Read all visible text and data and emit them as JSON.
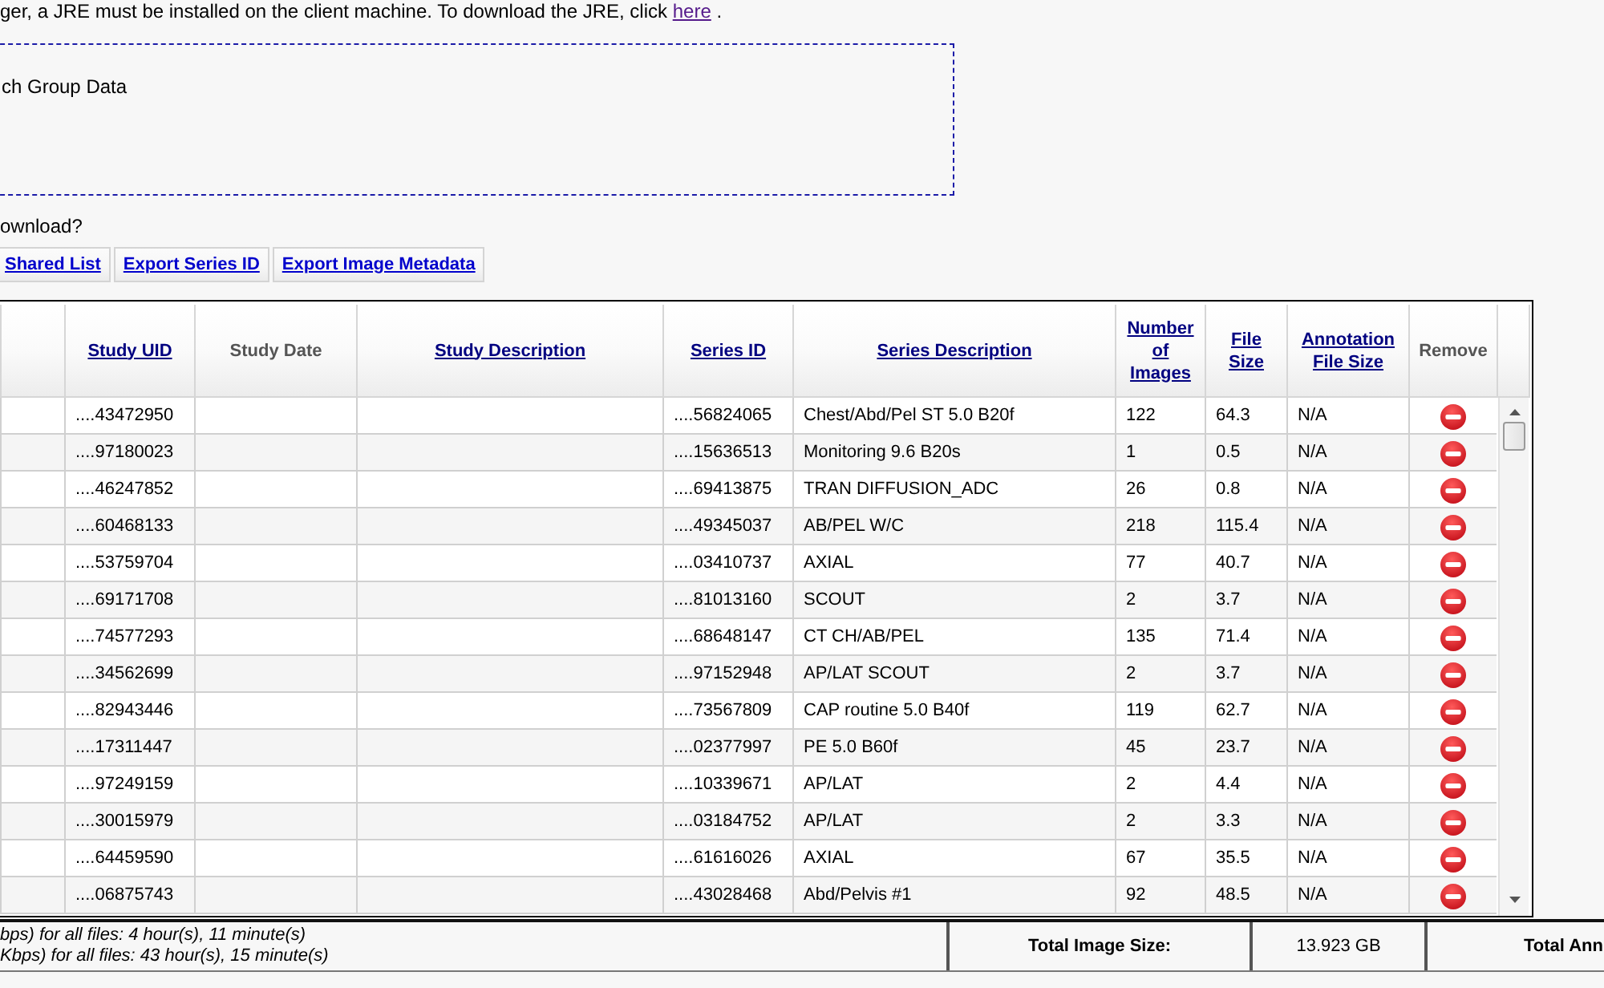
{
  "notice": {
    "text": "ger, a JRE must be installed on the client machine. To download the JRE, click",
    "link": "here",
    "suffix": "."
  },
  "group_box": {
    "label": "ch Group Data"
  },
  "question": "ownload?",
  "export_buttons": [
    "Shared List",
    "Export Series ID",
    "Export Image Metadata"
  ],
  "table": {
    "columns": [
      {
        "label": "Study UID",
        "sortable": true
      },
      {
        "label": "Study Date",
        "sortable": false
      },
      {
        "label": "Study Description",
        "sortable": true
      },
      {
        "label": "Series ID",
        "sortable": true
      },
      {
        "label": "Series Description",
        "sortable": true
      },
      {
        "label": "Number of Images",
        "sortable": true
      },
      {
        "label": "File Size",
        "sortable": true
      },
      {
        "label": "Annotation File Size",
        "sortable": true
      },
      {
        "label": "Remove",
        "sortable": false
      }
    ],
    "rows": [
      {
        "study_uid": "....43472950",
        "series_id": "....56824065",
        "series_description": "Chest/Abd/Pel ST 5.0 B20f",
        "images": "122",
        "file_size": "64.3",
        "annotation_size": "N/A"
      },
      {
        "study_uid": "....97180023",
        "series_id": "....15636513",
        "series_description": "Monitoring 9.6 B20s",
        "images": "1",
        "file_size": "0.5",
        "annotation_size": "N/A"
      },
      {
        "study_uid": "....46247852",
        "series_id": "....69413875",
        "series_description": "TRAN DIFFUSION_ADC",
        "images": "26",
        "file_size": "0.8",
        "annotation_size": "N/A"
      },
      {
        "study_uid": "....60468133",
        "series_id": "....49345037",
        "series_description": "AB/PEL W/C",
        "images": "218",
        "file_size": "115.4",
        "annotation_size": "N/A"
      },
      {
        "study_uid": "....53759704",
        "series_id": "....03410737",
        "series_description": "AXIAL",
        "images": "77",
        "file_size": "40.7",
        "annotation_size": "N/A"
      },
      {
        "study_uid": "....69171708",
        "series_id": "....81013160",
        "series_description": "SCOUT",
        "images": "2",
        "file_size": "3.7",
        "annotation_size": "N/A"
      },
      {
        "study_uid": "....74577293",
        "series_id": "....68648147",
        "series_description": "CT CH/AB/PEL",
        "images": "135",
        "file_size": "71.4",
        "annotation_size": "N/A"
      },
      {
        "study_uid": "....34562699",
        "series_id": "....97152948",
        "series_description": "AP/LAT SCOUT",
        "images": "2",
        "file_size": "3.7",
        "annotation_size": "N/A"
      },
      {
        "study_uid": "....82943446",
        "series_id": "....73567809",
        "series_description": "CAP routine 5.0 B40f",
        "images": "119",
        "file_size": "62.7",
        "annotation_size": "N/A"
      },
      {
        "study_uid": "....17311447",
        "series_id": "....02377997",
        "series_description": "PE 5.0 B60f",
        "images": "45",
        "file_size": "23.7",
        "annotation_size": "N/A"
      },
      {
        "study_uid": "....97249159",
        "series_id": "....10339671",
        "series_description": "AP/LAT",
        "images": "2",
        "file_size": "4.4",
        "annotation_size": "N/A"
      },
      {
        "study_uid": "....30015979",
        "series_id": "....03184752",
        "series_description": "AP/LAT",
        "images": "2",
        "file_size": "3.3",
        "annotation_size": "N/A"
      },
      {
        "study_uid": "....64459590",
        "series_id": "....61616026",
        "series_description": "AXIAL",
        "images": "67",
        "file_size": "35.5",
        "annotation_size": "N/A"
      },
      {
        "study_uid": "....06875743",
        "series_id": "....43028468",
        "series_description": "Abd/Pelvis #1",
        "images": "92",
        "file_size": "48.5",
        "annotation_size": "N/A"
      }
    ]
  },
  "footer": {
    "transfer_lines": [
      "bps) for all files: 4 hour(s), 11 minute(s)",
      "Kbps) for all files: 43 hour(s), 15 minute(s)"
    ],
    "total_image_size_label": "Total Image Size:",
    "total_image_size": "13.923 GB",
    "total_annotation_label": "Total Ann"
  }
}
